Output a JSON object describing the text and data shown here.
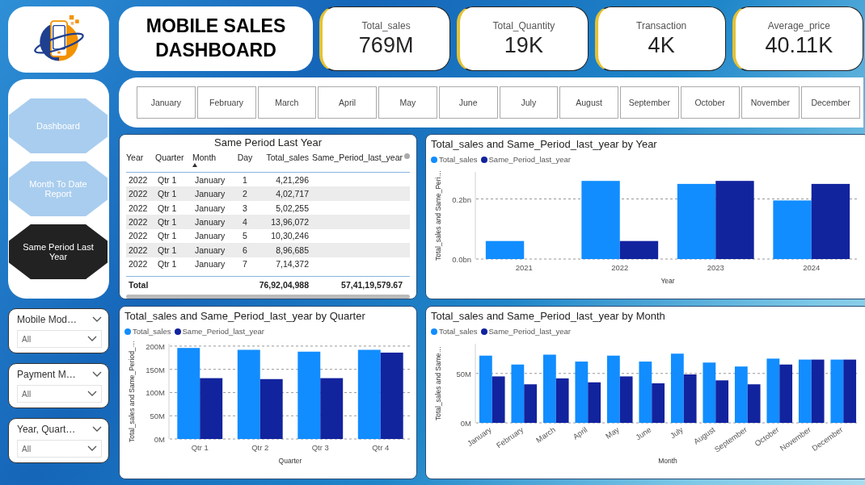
{
  "header": {
    "title": "MOBILE SALES DASHBOARD"
  },
  "kpis": [
    {
      "label": "Total_sales",
      "value": "769M"
    },
    {
      "label": "Total_Quantity",
      "value": "19K"
    },
    {
      "label": "Transaction",
      "value": "4K"
    },
    {
      "label": "Average_price",
      "value": "40.11K"
    }
  ],
  "nav": [
    {
      "label": "Dashboard",
      "selected": false
    },
    {
      "label": "Month To Date Report",
      "selected": false
    },
    {
      "label": "Same Period Last Year",
      "selected": true
    }
  ],
  "slicers": [
    {
      "title": "Mobile Mod…",
      "value": "All"
    },
    {
      "title": "Payment M…",
      "value": "All"
    },
    {
      "title": "Year, Quart…",
      "value": "All"
    }
  ],
  "months": [
    {
      "label": "January",
      "selected": false
    },
    {
      "label": "February",
      "selected": false
    },
    {
      "label": "March",
      "selected": false
    },
    {
      "label": "April",
      "selected": false
    },
    {
      "label": "May",
      "selected": false
    },
    {
      "label": "June",
      "selected": false
    },
    {
      "label": "July",
      "selected": false
    },
    {
      "label": "August",
      "selected": false
    },
    {
      "label": "September",
      "selected": false
    },
    {
      "label": "October",
      "selected": false
    },
    {
      "label": "November",
      "selected": false
    },
    {
      "label": "December",
      "selected": false
    }
  ],
  "same_period_table": {
    "title": "Same Period Last Year",
    "columns": [
      {
        "label": "Year",
        "sorted": false
      },
      {
        "label": "Quarter",
        "sorted": false
      },
      {
        "label": "Month",
        "sorted": true
      },
      {
        "label": "Day",
        "sorted": false
      },
      {
        "label": "Total_sales",
        "sorted": false
      },
      {
        "label": "Same_Period_last_year",
        "sorted": false
      }
    ],
    "rows": [
      [
        "2022",
        "Qtr 1",
        "January",
        "1",
        "4,21,296",
        ""
      ],
      [
        "2022",
        "Qtr 1",
        "January",
        "2",
        "4,02,717",
        ""
      ],
      [
        "2022",
        "Qtr 1",
        "January",
        "3",
        "5,02,255",
        ""
      ],
      [
        "2022",
        "Qtr 1",
        "January",
        "4",
        "13,96,072",
        ""
      ],
      [
        "2022",
        "Qtr 1",
        "January",
        "5",
        "10,30,246",
        ""
      ],
      [
        "2022",
        "Qtr 1",
        "January",
        "6",
        "8,96,685",
        ""
      ],
      [
        "2022",
        "Qtr 1",
        "January",
        "7",
        "7,14,372",
        ""
      ]
    ],
    "total": {
      "label": "Total",
      "total_sales": "76,92,04,988",
      "same_period_last_year": "57,41,19,579.67"
    }
  },
  "charts": [
    {
      "chart_data": {
        "type": "bar",
        "title": "Total_sales and Same_Period_last_year by Year",
        "xlabel": "Year",
        "ylabel": "Total_sales and Same_Peri…",
        "categories": [
          "2021",
          "2022",
          "2023",
          "2024"
        ],
        "series": [
          {
            "name": "Total_sales",
            "color": "#118dff",
            "values": [
              0.06,
              0.26,
              0.25,
              0.195
            ]
          },
          {
            "name": "Same_Period_last_year",
            "color": "#12239e",
            "values": [
              null,
              0.06,
              0.26,
              0.25
            ]
          }
        ],
        "ylim": [
          0,
          0.29
        ],
        "legend": "top-left",
        "grid": true,
        "yticks": [
          {
            "value": 0,
            "label": "0.0bn"
          },
          {
            "value": 0.2,
            "label": "0.2bn"
          }
        ]
      }
    },
    {
      "chart_data": {
        "type": "bar",
        "title": "Total_sales and Same_Period_last_year by Quarter",
        "xlabel": "Quarter",
        "ylabel": "Total_sales and Same_Period_…",
        "categories": [
          "Qtr 1",
          "Qtr 2",
          "Qtr 3",
          "Qtr 4"
        ],
        "series": [
          {
            "name": "Total_sales",
            "color": "#118dff",
            "values": [
              196,
              192,
              188,
              192
            ]
          },
          {
            "name": "Same_Period_last_year",
            "color": "#12239e",
            "values": [
              131,
              129,
              131,
              186
            ]
          }
        ],
        "ylim": [
          0,
          205
        ],
        "legend": "top-left",
        "grid": true,
        "yticks": [
          {
            "value": 0,
            "label": "0M"
          },
          {
            "value": 50,
            "label": "50M"
          },
          {
            "value": 100,
            "label": "100M"
          },
          {
            "value": 150,
            "label": "150M"
          },
          {
            "value": 200,
            "label": "200M"
          }
        ]
      }
    },
    {
      "chart_data": {
        "type": "bar",
        "title": "Total_sales and Same_Period_last_year by Month",
        "xlabel": "Month",
        "ylabel": "Total_sales and Same…",
        "categories": [
          "January",
          "February",
          "March",
          "April",
          "May",
          "June",
          "July",
          "August",
          "September",
          "October",
          "November",
          "December"
        ],
        "series": [
          {
            "name": "Total_sales",
            "color": "#118dff",
            "values": [
              68,
              59,
              69,
              62,
              68,
              62,
              70,
              61,
              57,
              65,
              64,
              64
            ]
          },
          {
            "name": "Same_Period_last_year",
            "color": "#12239e",
            "values": [
              47,
              39,
              45,
              41,
              47,
              40,
              49,
              43,
              39,
              59,
              64,
              64
            ]
          }
        ],
        "ylim": [
          0,
          80
        ],
        "legend": "top-left",
        "grid": true,
        "yticks": [
          {
            "value": 0,
            "label": "0M"
          },
          {
            "value": 50,
            "label": "50M"
          }
        ]
      }
    }
  ]
}
